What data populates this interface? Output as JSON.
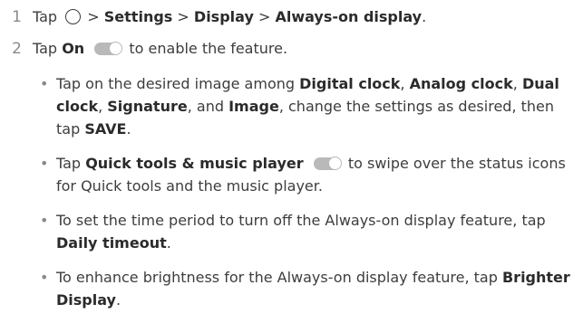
{
  "step1": {
    "number": "1",
    "tap": "Tap",
    "sep1": ">",
    "settings": "Settings",
    "sep2": ">",
    "display": "Display",
    "sep3": ">",
    "always_on": "Always-on display",
    "end": "."
  },
  "step2": {
    "number": "2",
    "tap": "Tap",
    "on": "On",
    "rest": "to enable the feature."
  },
  "bullets": {
    "b1": {
      "t1": "Tap on the desired image among",
      "digital": "Digital clock",
      "c1": ",",
      "analog": "Analog clock",
      "c2": ",",
      "dual": "Dual clock",
      "c3": ",",
      "signature": "Signature",
      "c4": ", and",
      "image": "Image",
      "t2": ", change the settings as desired, then tap",
      "save": "SAVE",
      "end": "."
    },
    "b2": {
      "tap": "Tap",
      "quick": "Quick tools & music player",
      "rest": "to swipe over the status icons for Quick tools and the music player."
    },
    "b3": {
      "text": "To set the time period to turn off the Always-on display feature, tap",
      "daily": "Daily timeout",
      "end": "."
    },
    "b4": {
      "text": "To enhance brightness for the Always-on display feature, tap",
      "brighter": "Brighter Display",
      "end": "."
    }
  },
  "icons": {
    "home": "home-circle-icon",
    "toggle": "toggle-switch-icon"
  }
}
